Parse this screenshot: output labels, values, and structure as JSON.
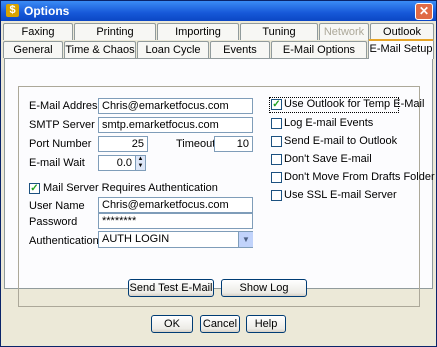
{
  "window": {
    "title": "Options",
    "app_icon": "dollar-icon",
    "close_glyph": "✕"
  },
  "tabs_row1": [
    {
      "label": "Faxing",
      "state": "normal"
    },
    {
      "label": "Printing",
      "state": "normal"
    },
    {
      "label": "Importing",
      "state": "normal"
    },
    {
      "label": "Tuning",
      "state": "normal"
    },
    {
      "label": "Network",
      "state": "disabled"
    },
    {
      "label": "Outlook",
      "state": "normal"
    }
  ],
  "tabs_row2": [
    {
      "label": "General",
      "state": "normal"
    },
    {
      "label": "Time & Chaos",
      "state": "normal"
    },
    {
      "label": "Loan Cycle",
      "state": "normal"
    },
    {
      "label": "Events",
      "state": "normal"
    },
    {
      "label": "E-Mail Options",
      "state": "normal"
    },
    {
      "label": "E-Mail Setup",
      "state": "active"
    }
  ],
  "form": {
    "email_address_label": "E-Mail Address",
    "email_address_value": "Chris@emarketfocus.com",
    "smtp_label": "SMTP Server",
    "smtp_value": "smtp.emarketfocus.com",
    "port_label": "Port Number",
    "port_value": "25",
    "timeout_label": "Timeout",
    "timeout_value": "10",
    "wait_label": "E-mail Wait",
    "wait_value": "0.0",
    "auth_required_label": "Mail Server Requires Authentication",
    "auth_required_checked": true,
    "username_label": "User Name",
    "username_value": "Chris@emarketfocus.com",
    "password_label": "Password",
    "password_value": "********",
    "authentication_label": "Authentication",
    "authentication_value": "AUTH LOGIN"
  },
  "options": [
    {
      "label": "Use Outlook for Temp E-Mail",
      "checked": true
    },
    {
      "label": "Log E-mail Events",
      "checked": false
    },
    {
      "label": "Send E-mail to Outlook",
      "checked": false
    },
    {
      "label": "Don't Save E-mail",
      "checked": false
    },
    {
      "label": "Don't Move From Drafts Folder",
      "checked": false
    },
    {
      "label": "Use SSL E-mail Server",
      "checked": false
    }
  ],
  "buttons": {
    "send_test": "Send Test E-Mail",
    "show_log": "Show Log",
    "ok": "OK",
    "cancel": "Cancel",
    "help": "Help"
  }
}
